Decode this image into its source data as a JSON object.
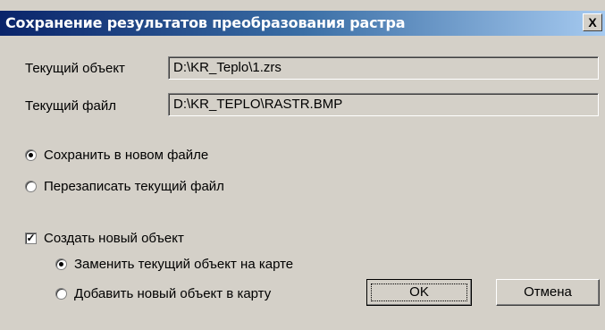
{
  "dialog": {
    "title": "Сохранение результатов преобразования растра",
    "close_label": "X"
  },
  "fields": {
    "current_object_label": "Текущий объект",
    "current_object_value": "D:\\KR_Teplo\\1.zrs",
    "current_file_label": "Текущий файл",
    "current_file_value": "D:\\KR_TEPLO\\RASTR.BMP"
  },
  "save_mode": {
    "options": [
      "Сохранить в новом файле",
      "Перезаписать текущий файл"
    ],
    "selected_index": 0
  },
  "create_object": {
    "label": "Создать новый объект",
    "checked": true,
    "options": [
      "Заменить текущий объект на карте",
      "Добавить новый объект в карту"
    ],
    "selected_index": 0
  },
  "buttons": {
    "ok_label": "OK",
    "cancel_label": "Отмена"
  }
}
